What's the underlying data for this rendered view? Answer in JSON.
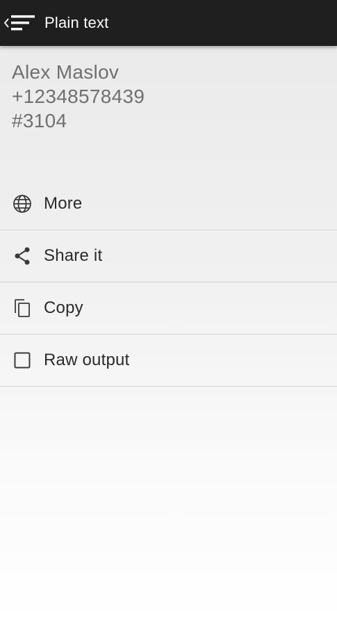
{
  "header": {
    "title": "Plain text",
    "back_icon": "chevron-left-icon",
    "menu_icon": "sort-lines-icon"
  },
  "result": {
    "lines": [
      "Alex Maslov",
      "+12348578439",
      "#3104"
    ]
  },
  "actions": [
    {
      "label": "More",
      "icon": "globe-icon"
    },
    {
      "label": "Share it",
      "icon": "share-icon"
    },
    {
      "label": "Copy",
      "icon": "copy-icon"
    },
    {
      "label": "Raw output",
      "icon": "checkbox-icon",
      "checked": false
    }
  ],
  "colors": {
    "topbar": "#1f1f1f",
    "result_text": "#707070",
    "action_text": "#2a2a2a",
    "divider": "#d2d2d2"
  }
}
